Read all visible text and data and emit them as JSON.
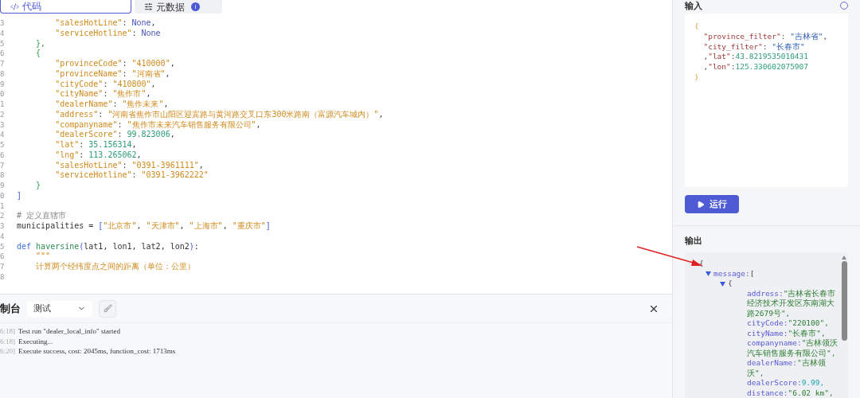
{
  "tabs": [
    {
      "label": "代码",
      "selected": true,
      "kind": "code"
    },
    {
      "label": "元数据",
      "selected": false,
      "kind": "meta",
      "badge": "i"
    }
  ],
  "code_lines": [
    {
      "number": "3",
      "tokens": [
        {
          "text": "        \"salesHotLine\"",
          "kind": "str"
        },
        {
          "text": ": ",
          "kind": "punc"
        },
        {
          "text": "None",
          "kind": "none"
        },
        {
          "text": ",",
          "kind": "punc"
        }
      ]
    },
    {
      "number": "4",
      "tokens": [
        {
          "text": "        \"serviceHotline\"",
          "kind": "str"
        },
        {
          "text": ": ",
          "kind": "punc"
        },
        {
          "text": "None",
          "kind": "none"
        }
      ]
    },
    {
      "number": "5",
      "tokens": [
        {
          "text": "    },",
          "kind": "brace"
        }
      ]
    },
    {
      "number": "6",
      "tokens": [
        {
          "text": "    {",
          "kind": "brace"
        }
      ]
    },
    {
      "number": "7",
      "tokens": [
        {
          "text": "        \"provinceCode\"",
          "kind": "str"
        },
        {
          "text": ": ",
          "kind": "punc"
        },
        {
          "text": "\"410000\"",
          "kind": "str"
        },
        {
          "text": ",",
          "kind": "punc"
        }
      ]
    },
    {
      "number": "8",
      "tokens": [
        {
          "text": "        \"provinceName\"",
          "kind": "str"
        },
        {
          "text": ": ",
          "kind": "punc"
        },
        {
          "text": "\"河南省\"",
          "kind": "str"
        },
        {
          "text": ",",
          "kind": "punc"
        }
      ]
    },
    {
      "number": "9",
      "tokens": [
        {
          "text": "        \"cityCode\"",
          "kind": "str"
        },
        {
          "text": ": ",
          "kind": "punc"
        },
        {
          "text": "\"410800\"",
          "kind": "str"
        },
        {
          "text": ",",
          "kind": "punc"
        }
      ]
    },
    {
      "number": "0",
      "tokens": [
        {
          "text": "        \"cityName\"",
          "kind": "str"
        },
        {
          "text": ": ",
          "kind": "punc"
        },
        {
          "text": "\"焦作市\"",
          "kind": "str"
        },
        {
          "text": ",",
          "kind": "punc"
        }
      ]
    },
    {
      "number": "1",
      "tokens": [
        {
          "text": "        \"dealerName\"",
          "kind": "str"
        },
        {
          "text": ": ",
          "kind": "punc"
        },
        {
          "text": "\"焦作未来\"",
          "kind": "str"
        },
        {
          "text": ",",
          "kind": "punc"
        }
      ]
    },
    {
      "number": "2",
      "tokens": [
        {
          "text": "        \"address\"",
          "kind": "str"
        },
        {
          "text": ": ",
          "kind": "punc"
        },
        {
          "text": "\"河南省焦作市山阳区迎宾路与黄河路交叉口东300米路南（富源汽车城内）\"",
          "kind": "str"
        },
        {
          "text": ",",
          "kind": "punc"
        }
      ]
    },
    {
      "number": "3",
      "tokens": [
        {
          "text": "        \"companyname\"",
          "kind": "str"
        },
        {
          "text": ": ",
          "kind": "punc"
        },
        {
          "text": "\"焦作市未来汽车销售服务有限公司\"",
          "kind": "str"
        },
        {
          "text": ",",
          "kind": "punc"
        }
      ]
    },
    {
      "number": "4",
      "tokens": [
        {
          "text": "        \"dealerScore\"",
          "kind": "str"
        },
        {
          "text": ": ",
          "kind": "punc"
        },
        {
          "text": "99.823006",
          "kind": "num"
        },
        {
          "text": ",",
          "kind": "punc"
        }
      ]
    },
    {
      "number": "5",
      "tokens": [
        {
          "text": "        \"lat\"",
          "kind": "str"
        },
        {
          "text": ": ",
          "kind": "punc"
        },
        {
          "text": "35.156314",
          "kind": "num"
        },
        {
          "text": ",",
          "kind": "punc"
        }
      ]
    },
    {
      "number": "6",
      "tokens": [
        {
          "text": "        \"lng\"",
          "kind": "str"
        },
        {
          "text": ": ",
          "kind": "punc"
        },
        {
          "text": "113.265062",
          "kind": "num"
        },
        {
          "text": ",",
          "kind": "punc"
        }
      ]
    },
    {
      "number": "7",
      "tokens": [
        {
          "text": "        \"salesHotLine\"",
          "kind": "str"
        },
        {
          "text": ": ",
          "kind": "punc"
        },
        {
          "text": "\"0391-3961111\"",
          "kind": "str"
        },
        {
          "text": ",",
          "kind": "punc"
        }
      ]
    },
    {
      "number": "8",
      "tokens": [
        {
          "text": "        \"serviceHotline\"",
          "kind": "str"
        },
        {
          "text": ": ",
          "kind": "punc"
        },
        {
          "text": "\"0391-3962222\"",
          "kind": "str"
        }
      ]
    },
    {
      "number": "9",
      "tokens": [
        {
          "text": "    }",
          "kind": "brace"
        }
      ]
    },
    {
      "number": "0",
      "tokens": [
        {
          "text": "]",
          "kind": "bracket"
        }
      ]
    },
    {
      "number": "1"
    },
    {
      "number": "2",
      "tokens": [
        {
          "text": "# 定义直辖市",
          "kind": "comment"
        }
      ]
    },
    {
      "number": "3",
      "tokens": [
        {
          "text": "municipalities = ",
          "kind": "plain"
        },
        {
          "text": "[",
          "kind": "bracket"
        },
        {
          "text": "\"北京市\"",
          "kind": "str"
        },
        {
          "text": ", ",
          "kind": "punc"
        },
        {
          "text": "\"天津市\"",
          "kind": "str"
        },
        {
          "text": ", ",
          "kind": "punc"
        },
        {
          "text": "\"上海市\"",
          "kind": "str"
        },
        {
          "text": ", ",
          "kind": "punc"
        },
        {
          "text": "\"重庆市\"",
          "kind": "str"
        },
        {
          "text": "]",
          "kind": "bracket"
        }
      ]
    },
    {
      "number": "4"
    },
    {
      "number": "5",
      "tokens": [
        {
          "text": "def ",
          "kind": "kw"
        },
        {
          "text": "haversine",
          "kind": "fn"
        },
        {
          "text": "(",
          "kind": "bracket"
        },
        {
          "text": "lat1, lon1, lat2, lon2",
          "kind": "plain"
        },
        {
          "text": ")",
          "kind": "bracket"
        },
        {
          "text": ":",
          "kind": "plain"
        }
      ]
    },
    {
      "number": "6",
      "tokens": [
        {
          "text": "    \"\"\"",
          "kind": "str"
        }
      ]
    },
    {
      "number": "7",
      "tokens": [
        {
          "text": "    计算两个经纬度点之间的距离（单位：公里）",
          "kind": "str"
        }
      ]
    },
    {
      "number": "8"
    }
  ],
  "console": {
    "title": "制台",
    "env": "测试",
    "logs": [
      {
        "time": "6:18]",
        "message": "Test run \"dealer_local_info\" started"
      },
      {
        "time": "6:18]",
        "message": "Executing..."
      },
      {
        "time": "6:20]",
        "message": "Execute success, cost: 2045ms, function_cost: 1713ms"
      }
    ]
  },
  "input": {
    "title": "输入",
    "lines": [
      {
        "tokens": [
          {
            "text": "{",
            "kind": "brace2"
          }
        ]
      },
      {
        "tokens": [
          {
            "text": "  \"province_filter\"",
            "kind": "key"
          },
          {
            "text": ": ",
            "kind": "punc"
          },
          {
            "text": "\"吉林省\"",
            "kind": "value"
          },
          {
            "text": ",",
            "kind": "punc"
          }
        ]
      },
      {
        "tokens": [
          {
            "text": "  \"city_filter\"",
            "kind": "key"
          },
          {
            "text": ": ",
            "kind": "punc"
          },
          {
            "text": "\"长春市\"",
            "kind": "value"
          }
        ]
      },
      {
        "tokens": [
          {
            "text": "  ,",
            "kind": "punc"
          },
          {
            "text": "\"lat\"",
            "kind": "key"
          },
          {
            "text": ":",
            "kind": "punc"
          },
          {
            "text": "43.8219535010431",
            "kind": "num"
          }
        ]
      },
      {
        "tokens": [
          {
            "text": "  ,",
            "kind": "punc"
          },
          {
            "text": "\"lon\"",
            "kind": "key"
          },
          {
            "text": ":",
            "kind": "punc"
          },
          {
            "text": "125.330602075907",
            "kind": "num"
          }
        ]
      },
      {
        "tokens": [
          {
            "text": "}",
            "kind": "brace2"
          }
        ]
      }
    ]
  },
  "run_button": "运行",
  "output": {
    "title": "输出",
    "root": {
      "open": "{",
      "children": [
        {
          "key": "message:",
          "open": "[",
          "expanded": true,
          "children": [
            {
              "open": "{",
              "expanded": true,
              "fields": [
                {
                  "key": "address:",
                  "value": "\"吉林省长春市经济技术开发区东南湖大路2679号\",",
                  "kind": "str"
                },
                {
                  "key": "cityCode:",
                  "value": "\"220100\",",
                  "kind": "str"
                },
                {
                  "key": "cityName:",
                  "value": "\"长春市\",",
                  "kind": "str"
                },
                {
                  "key": "companyname:",
                  "value": "\"吉林领沃汽车销售服务有限公司\",",
                  "kind": "str"
                },
                {
                  "key": "dealerName:",
                  "value": "\"吉林领沃\",",
                  "kind": "str"
                },
                {
                  "key": "dealerScore:",
                  "value": "9.99,",
                  "kind": "num"
                },
                {
                  "key": "distance:",
                  "value": "\"6.02 km\",",
                  "kind": "str"
                }
              ]
            }
          ]
        }
      ]
    }
  }
}
